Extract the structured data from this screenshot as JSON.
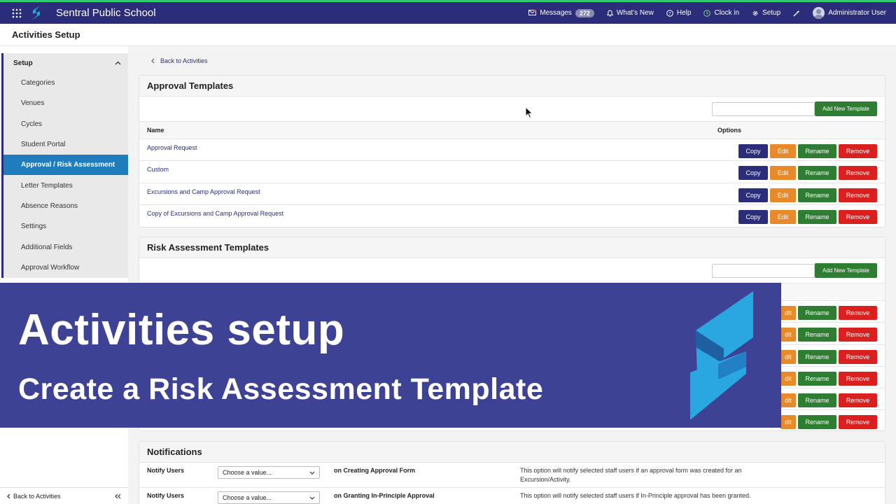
{
  "topbar": {
    "school_name": "Sentral Public School",
    "messages_label": "Messages",
    "messages_count": "272",
    "whats_new_label": "What's New",
    "help_label": "Help",
    "clock_in_label": "Clock in",
    "setup_label": "Setup",
    "user_label": "Administrator User",
    "accent_color": "#2ecc71",
    "bg_color": "#2b2d7b"
  },
  "page": {
    "title": "Activities Setup"
  },
  "sidebar": {
    "group_label": "Setup",
    "items": [
      {
        "label": "Categories"
      },
      {
        "label": "Venues"
      },
      {
        "label": "Cycles"
      },
      {
        "label": "Student Portal"
      },
      {
        "label": "Approval / Risk Assessment",
        "active": true
      },
      {
        "label": "Letter Templates"
      },
      {
        "label": "Absence Reasons"
      },
      {
        "label": "Settings"
      },
      {
        "label": "Additional Fields"
      },
      {
        "label": "Approval Workflow"
      }
    ],
    "footer_back": "Back to Activities"
  },
  "main": {
    "back_link": "Back to Activities",
    "approval": {
      "title": "Approval Templates",
      "add_button": "Add New Template",
      "col_name": "Name",
      "col_options": "Options",
      "rows": [
        {
          "name": "Approval Request"
        },
        {
          "name": "Custom"
        },
        {
          "name": "Excursions and Camp Approval Request"
        },
        {
          "name": "Copy of Excursions and Camp Approval Request"
        }
      ]
    },
    "risk": {
      "title": "Risk Assessment Templates",
      "add_button": "Add New Template",
      "visible_rows": 6
    },
    "buttons": {
      "copy": "Copy",
      "edit": "Edit",
      "rename": "Rename",
      "remove": "Remove",
      "partial_edit": "dit"
    },
    "notifications": {
      "title": "Notifications",
      "rows": [
        {
          "label": "Notify Users",
          "select": "Choose a value...",
          "event": "on Creating Approval Form",
          "desc": "This option will notify selected staff users if an approval form was created for an Excursion/Activity."
        },
        {
          "label": "Notify Users",
          "select": "Choose a value...",
          "event": "on Granting In-Principle Approval",
          "desc": "This option will notify selected staff users if In-Principle approval has been granted."
        }
      ]
    }
  },
  "banner": {
    "title": "Activities setup",
    "subtitle": "Create a Risk Assessment Template",
    "bg_color": "#3e4295"
  }
}
